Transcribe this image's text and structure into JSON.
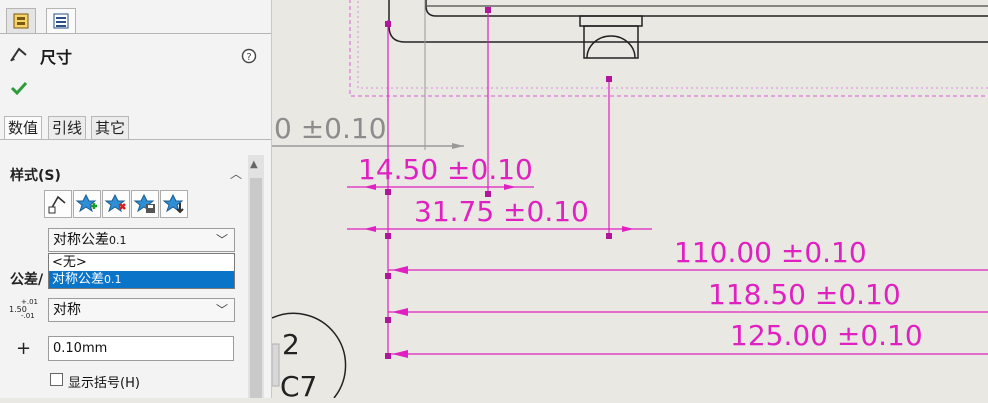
{
  "panel": {
    "title": "尺寸",
    "help_icon": "question-circle-icon",
    "tabs": [
      "数值",
      "引线",
      "其它"
    ],
    "style_section": {
      "label": "样式(S)",
      "toolbar_icons": [
        "dimension-style-icon",
        "add-style-icon",
        "delete-style-icon",
        "save-style-icon",
        "load-style-icon"
      ]
    },
    "tolerance_type": {
      "selected": "对称公差",
      "selected_suffix": "0.1",
      "options": [
        {
          "label": "<无>",
          "suffix": ""
        },
        {
          "label": "对称公差",
          "suffix": "0.1"
        }
      ]
    },
    "tolerance_section": {
      "label": "公差/",
      "precision_select": "对称",
      "plus_label": "+",
      "value": "0.10mm",
      "show_parens_label": "显示括号(H)",
      "precision_icon_lines": [
        "+.01",
        "1.50",
        "-.01"
      ]
    }
  },
  "drawing": {
    "dimensions": [
      "14.50 ±0.10",
      "31.75 ±0.10",
      "110.00 ±0.10",
      "118.50 ±0.10",
      "125.00 ±0.10"
    ],
    "partial_dimension": "0 ±0.10",
    "partial_labels": [
      "2",
      "C7"
    ],
    "colors": {
      "dimension": "#e020c0",
      "leftover_dimension": "#8c8c8c",
      "background": "#e9e8e3"
    }
  }
}
